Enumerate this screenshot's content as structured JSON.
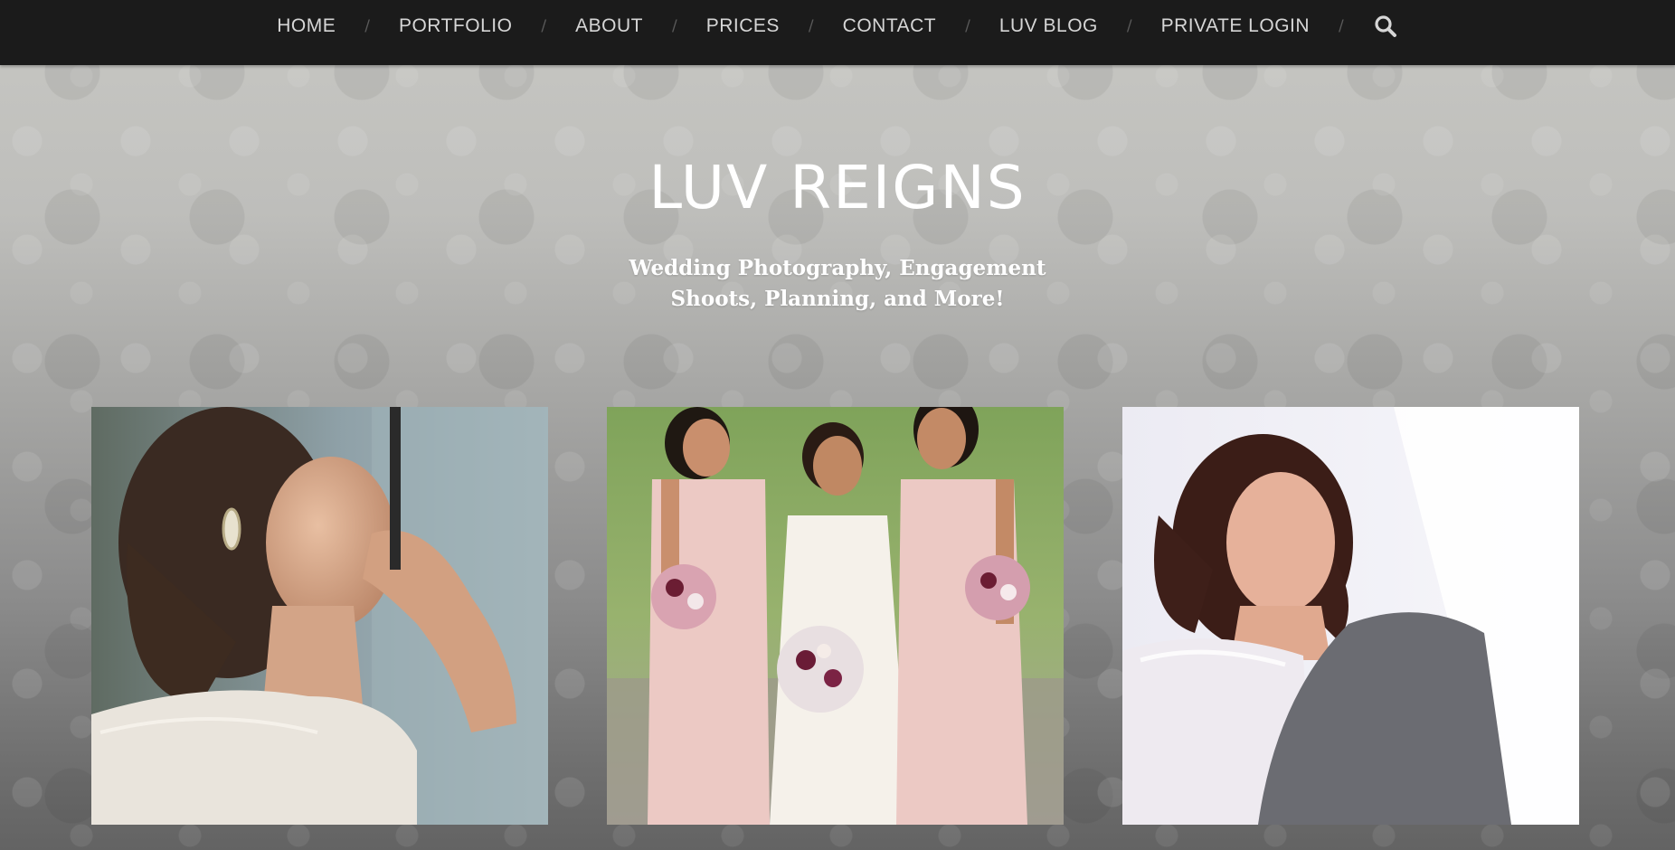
{
  "nav": {
    "items": [
      {
        "label": "HOME"
      },
      {
        "label": "PORTFOLIO"
      },
      {
        "label": "ABOUT"
      },
      {
        "label": "PRICES"
      },
      {
        "label": "CONTACT"
      },
      {
        "label": "LUV BLOG"
      },
      {
        "label": "PRIVATE LOGIN"
      }
    ],
    "separator": "/",
    "search_icon": "search-icon"
  },
  "hero": {
    "title": "LUV REIGNS",
    "tagline_line1": "Wedding Photography, Engagement",
    "tagline_line2": "Shoots, Planning, and More!"
  },
  "gallery": {
    "photos": [
      {
        "subject": "bride-getting-ready"
      },
      {
        "subject": "bride-with-bridesmaids"
      },
      {
        "subject": "bride-at-ceremony"
      }
    ]
  },
  "colors": {
    "nav_background": "#1b1b1b",
    "nav_text": "#d6d6d6",
    "hero_text": "#ffffff",
    "bridesmaid_dress": "#e8c4c0"
  }
}
